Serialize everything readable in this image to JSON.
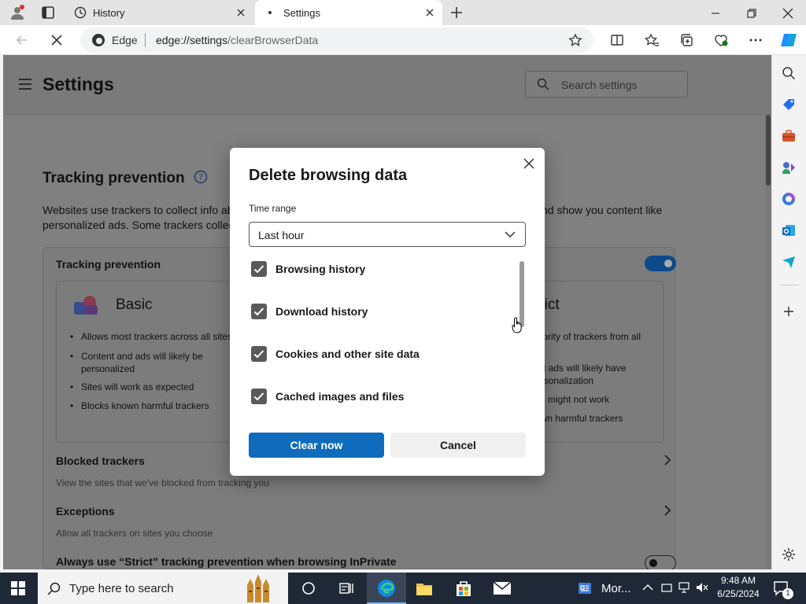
{
  "colors": {
    "accent": "#0f6cbd",
    "toggle_on": "#0d4a8a",
    "taskbar": "#1e2836"
  },
  "tabs": [
    {
      "title": "History",
      "icon": "history-icon"
    },
    {
      "title": "Settings",
      "icon": "loading-icon"
    }
  ],
  "address": {
    "site_label": "Edge",
    "url_bold": "edge://settings",
    "url_rest": "/clearBrowserData"
  },
  "settings": {
    "title": "Settings",
    "search_placeholder": "Search settings",
    "tracking": {
      "title": "Tracking prevention",
      "desc_line1": "Websites use trackers to collect info ab",
      "desc_line1_right": "nd show you content like",
      "desc_line2": "personalized ads. Some trackers collec",
      "card_label": "Tracking prevention",
      "enabled": true,
      "basic": {
        "title": "Basic",
        "bullets": [
          "Allows most trackers across all sites",
          "Content and ads will likely be personalized",
          "Sites will work as expected",
          "Blocks known harmful trackers"
        ]
      },
      "strict": {
        "title": "trict",
        "bullets": [
          "ajority of trackers from all",
          "nd ads will likely have ersonalization",
          "es might not work",
          "own harmful trackers"
        ]
      },
      "blocked": "Blocked trackers",
      "blocked_sub": "View the sites that we've blocked from tracking you",
      "exceptions": "Exceptions",
      "exceptions_sub": "Allow all trackers on sites you choose",
      "inprivate": "Always use “Strict” tracking prevention when browsing InPrivate",
      "inprivate_enabled": false
    }
  },
  "dialog": {
    "title": "Delete browsing data",
    "time_range_label": "Time range",
    "time_range_value": "Last hour",
    "items": [
      {
        "label": "Browsing history",
        "checked": true
      },
      {
        "label": "Download history",
        "checked": true
      },
      {
        "label": "Cookies and other site data",
        "checked": true
      },
      {
        "label": "Cached images and files",
        "checked": true
      }
    ],
    "clear_label": "Clear now",
    "cancel_label": "Cancel"
  },
  "taskbar": {
    "search_placeholder": "Type here to search",
    "weather_label": "Mor...",
    "time": "9:48 AM",
    "date": "6/25/2024",
    "notification_count": "1"
  }
}
